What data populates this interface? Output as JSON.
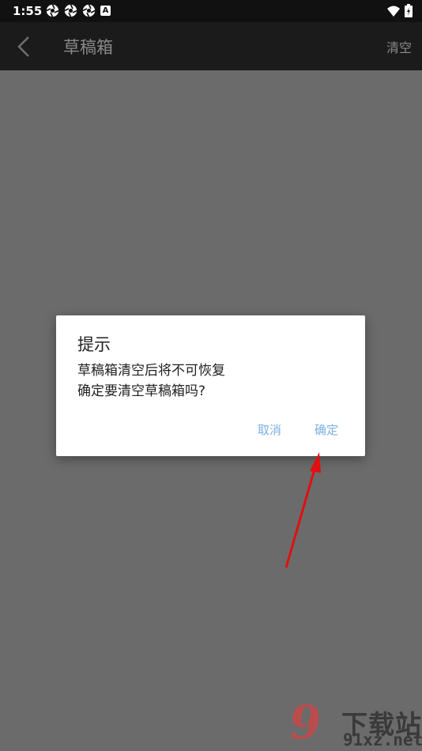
{
  "status_bar": {
    "time": "1:55",
    "a_badge": "A"
  },
  "app_bar": {
    "title": "草稿箱",
    "clear_label": "清空"
  },
  "dialog": {
    "title": "提示",
    "message_line1": "草稿箱清空后将不可恢复",
    "message_line2": "确定要清空草稿箱吗?",
    "cancel_label": "取消",
    "confirm_label": "确定"
  },
  "watermark": {
    "brand_cn": "下载站",
    "url": "91xz.net",
    "logo_digit": "9"
  },
  "colors": {
    "overlay": "#6b6b6b",
    "app_bar": "#1b1b1b",
    "status_bar": "#111111",
    "dialog_button": "#7ab0e0",
    "annotation_arrow": "#e01010"
  }
}
